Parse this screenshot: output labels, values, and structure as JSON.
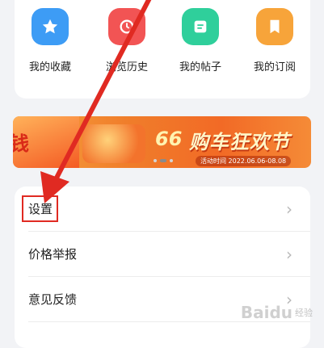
{
  "quick_actions": [
    {
      "label": "我的收藏",
      "icon": "star-icon",
      "color": "#3d9cf5"
    },
    {
      "label": "浏览历史",
      "icon": "history-icon",
      "color": "#f25454"
    },
    {
      "label": "我的帖子",
      "icon": "post-icon",
      "color": "#2fcf9b"
    },
    {
      "label": "我的订阅",
      "icon": "bookmark-icon",
      "color": "#f7a43a"
    }
  ],
  "banner": {
    "left_text": "钱",
    "number": "66",
    "title": "购车狂欢节",
    "date": "活动时间 2022.06.06-08.08"
  },
  "menu": [
    {
      "label": "设置"
    },
    {
      "label": "价格举报"
    },
    {
      "label": "意见反馈"
    }
  ],
  "chevron": "›",
  "watermark": {
    "text": "Baidu",
    "sub": "经验"
  },
  "annotation_color": "#e02a22"
}
